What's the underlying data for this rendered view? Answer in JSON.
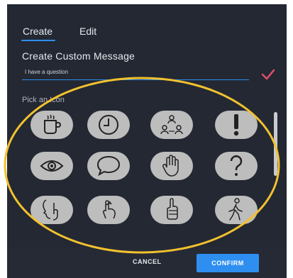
{
  "tabs": [
    {
      "label": "Create",
      "active": true
    },
    {
      "label": "Edit",
      "active": false
    }
  ],
  "heading": "Create Custom Message",
  "message_input": {
    "value": "I have a question"
  },
  "pick_icon_label": "Pick an Icon",
  "icons": [
    "coffee-cup-icon",
    "clock-icon",
    "group-discussion-icon",
    "exclamation-icon",
    "eye-icon",
    "speech-bubble-icon",
    "raised-hand-icon",
    "question-mark-icon",
    "shush-finger-icon",
    "finger-string-icon",
    "thumbs-up-icon",
    "walking-person-icon"
  ],
  "buttons": {
    "cancel": "CANCEL",
    "confirm": "CONFIRM"
  },
  "colors": {
    "panel": "#232833",
    "accent": "#2e8ff0",
    "check": "#e0506a",
    "highlight_ellipse": "#f2c12e",
    "icon_bg": "#bdbdbd"
  }
}
